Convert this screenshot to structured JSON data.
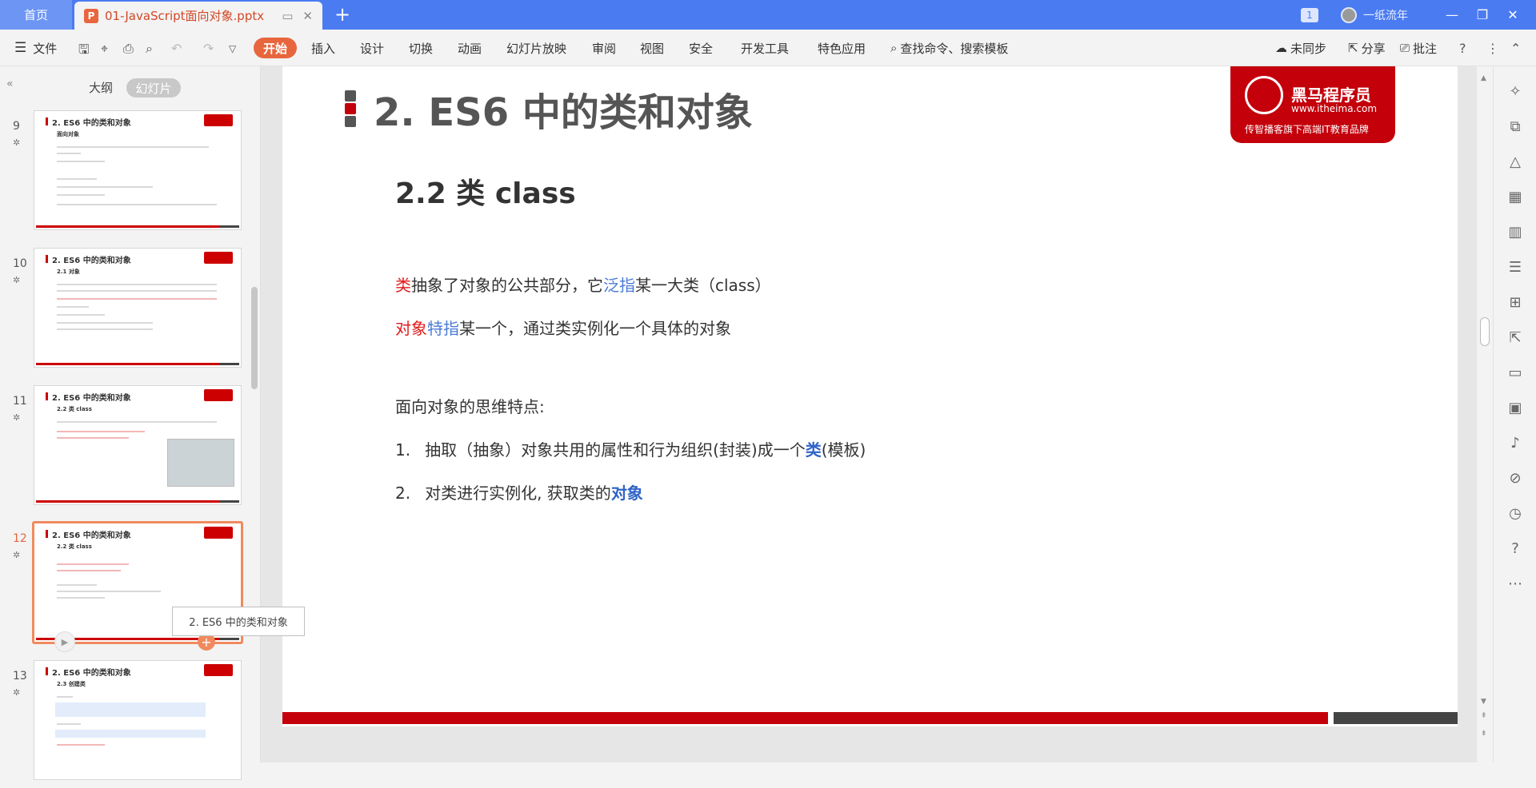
{
  "tabbar": {
    "home_label": "首页",
    "doc_title": "01-JavaScript面向对象.pptx",
    "doc_icon": "P",
    "window_count": "1",
    "user_name": "一纸流年"
  },
  "ribbon": {
    "file_label": "文件",
    "start_label": "开始",
    "menu": [
      "插入",
      "设计",
      "切换",
      "动画",
      "幻灯片放映",
      "审阅",
      "视图",
      "安全",
      "开发工具",
      "特色应用"
    ],
    "search_label": "查找命令、搜索模板",
    "sync_label": "未同步",
    "share_label": "分享",
    "comment_label": "批注"
  },
  "panel": {
    "tab_outline": "大纲",
    "tab_slides": "幻灯片",
    "tooltip": "2. ES6 中的类和对象",
    "slides": [
      {
        "num": "9",
        "title": "2. ES6 中的类和对象",
        "subtitle": "面向对象"
      },
      {
        "num": "10",
        "title": "2. ES6 中的类和对象",
        "subtitle": "2.1 对象"
      },
      {
        "num": "11",
        "title": "2. ES6 中的类和对象",
        "subtitle": "2.2 类 class"
      },
      {
        "num": "12",
        "title": "2. ES6 中的类和对象",
        "subtitle": "2.2 类 class"
      },
      {
        "num": "13",
        "title": "2. ES6 中的类和对象",
        "subtitle": "2.3 创建类"
      }
    ]
  },
  "slide": {
    "title": "2. ES6 中的类和对象",
    "logo_name": "黑马程序员",
    "logo_url": "www.itheima.com",
    "logo_slogan": "传智播客旗下高端IT教育品牌",
    "subtitle": "2.2 类 class",
    "line1": {
      "a": "类",
      "b": "抽象了对象的公共部分，它",
      "c": "泛指",
      "d": "某一大类（class）"
    },
    "line2": {
      "a": "对象",
      "b": "特指",
      "c": "某一个，通过类实例化一个具体的对象"
    },
    "heading": "面向对象的思维特点:",
    "item1": {
      "num": "1.",
      "a": "抽取（抽象）对象共用的属性和行为组织(封装)成一个",
      "b": "类",
      "c": "(模板)"
    },
    "item2": {
      "num": "2.",
      "a": "对类进行实例化, 获取类的",
      "b": "对象"
    }
  },
  "colors": {
    "accent": "#e8663e",
    "tabbar": "#4a7bf1",
    "brand_red": "#c4000b"
  }
}
